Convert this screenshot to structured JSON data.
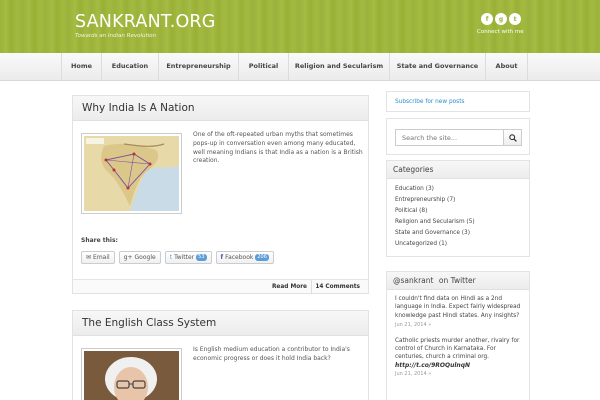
{
  "header": {
    "logo": "SANKRANT.ORG",
    "tagline": "Towards an Indian Revolution",
    "connect": "Connect with me",
    "social_icons": [
      "facebook-icon",
      "google-plus-icon",
      "twitter-icon"
    ]
  },
  "nav": {
    "items": [
      {
        "label": "Home"
      },
      {
        "label": "Education"
      },
      {
        "label": "Entrepreneurship"
      },
      {
        "label": "Political"
      },
      {
        "label": "Religion and Secularism"
      },
      {
        "label": "State and Governance"
      },
      {
        "label": "About"
      }
    ]
  },
  "posts": [
    {
      "title": "Why India Is A Nation",
      "excerpt": "One of the oft-repeated urban myths that sometimes pops-up in conversation even among many educated, well meaning Indians is that India as a nation is a British creation.",
      "share_label": "Share this:",
      "share": {
        "email": "Email",
        "google": "Google",
        "twitter": "Twitter",
        "twitter_count": "53",
        "facebook": "Facebook",
        "facebook_count": "206"
      },
      "read_more": "Read More",
      "comments": "14 Comments"
    },
    {
      "title": "The English Class System",
      "excerpt": "Is English medium education a contributor to India's economic progress or does it hold India back?"
    }
  ],
  "sidebar": {
    "subscribe": "Subscribe for new posts",
    "search_placeholder": "Search the site...",
    "categories_title": "Categories",
    "categories": [
      "Education (3)",
      "Entrepreneurship (7)",
      "Political (8)",
      "Religion and Secularism (5)",
      "State and Governance (3)",
      "Uncategorized (1)"
    ],
    "twitter_handle": "@sankrant",
    "twitter_title_suffix": "on Twitter",
    "tweets": [
      {
        "text": "I couldn't find data on Hindi as a 2nd language in India. Expect fairly widespread knowledge past Hindi states. Any insights?",
        "link": "",
        "date": "Jun 21, 2014 »"
      },
      {
        "text": "Catholic priests murder another, rivalry for control of Church in Karnataka. For centuries, church a criminal org.",
        "link": "http://t.co/9ROQulnqN",
        "date": "Jun 21, 2014 »"
      }
    ]
  },
  "colors": {
    "header_green": "#9bb33a",
    "link_blue": "#2a8fc7",
    "count_blue": "#5b9dd9"
  }
}
